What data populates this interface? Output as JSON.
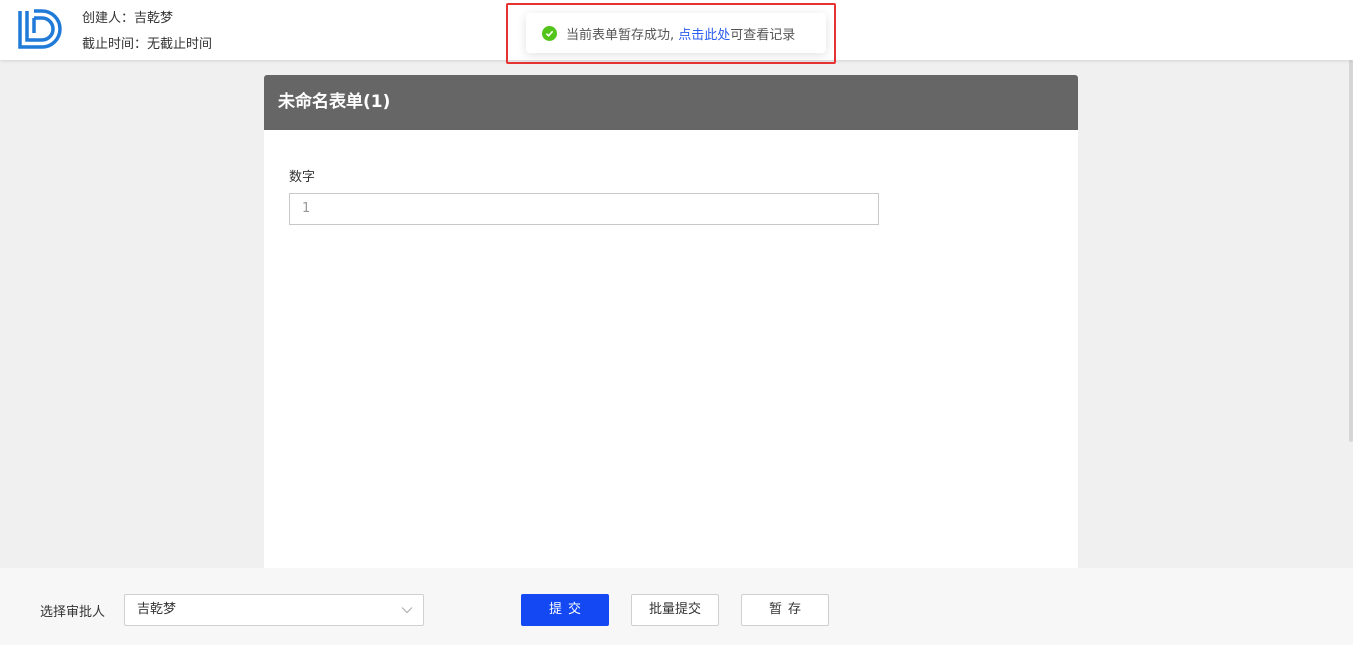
{
  "header": {
    "creator_label": "创建人：",
    "creator_name": "吉乾梦",
    "deadline_label": "截止时间：",
    "deadline_value": "无截止时间",
    "brand_color": "#1f7ad8"
  },
  "toast": {
    "message_prefix": "当前表单暂存成功,",
    "link_text": "点击此处",
    "message_suffix": "可查看记录",
    "status_icon": "check-circle-icon",
    "status_color": "#52c41a",
    "highlight_color": "#e53333"
  },
  "form": {
    "title": "未命名表单(1)",
    "fields": [
      {
        "label": "数字",
        "value": "1"
      }
    ]
  },
  "footer": {
    "approver_label": "选择审批人",
    "approver_value": "吉乾梦",
    "submit_label": "提交",
    "batch_submit_label": "批量提交",
    "save_draft_label": "暂存",
    "primary_color": "#1348f2"
  }
}
